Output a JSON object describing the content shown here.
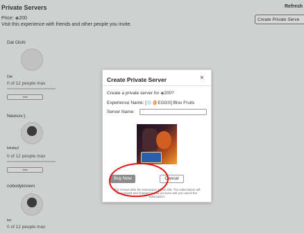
{
  "header": {
    "title": "Private Servers",
    "refresh": "Refresh",
    "price_label": "Price:",
    "price_value": "200",
    "description": "Visit this experience with friends and other people you invite.",
    "create_button": "Create Private Serve"
  },
  "servers": [
    {
      "owner": "Dat Oishi",
      "username": "Dat",
      "count": "0 of 12 people max",
      "join": "Join"
    },
    {
      "owner": "Newsxv:)",
      "username": "kimduyl",
      "count": "0 of 12 people max",
      "join": "Join"
    },
    {
      "owner": "nobodyknown",
      "username": "tez",
      "count": "0 of 12 people max"
    }
  ],
  "modal": {
    "title": "Create Private Server",
    "close": "×",
    "prompt_prefix": "Create a private server for",
    "prompt_price": "200?",
    "experience_label": "Experience Name:",
    "experience_name": "[❄️🥚EGGS] Blox Fruits",
    "server_name_label": "Server Name:",
    "server_name_value": "",
    "buy_now": "Buy Now",
    "cancel": "Cancel",
    "fine_print": "This renews after the transaction will be 200. The subscription will be renewed and charged to your account until you cancel the subscription."
  },
  "colors": {
    "annotation_circle": "#e01010"
  }
}
